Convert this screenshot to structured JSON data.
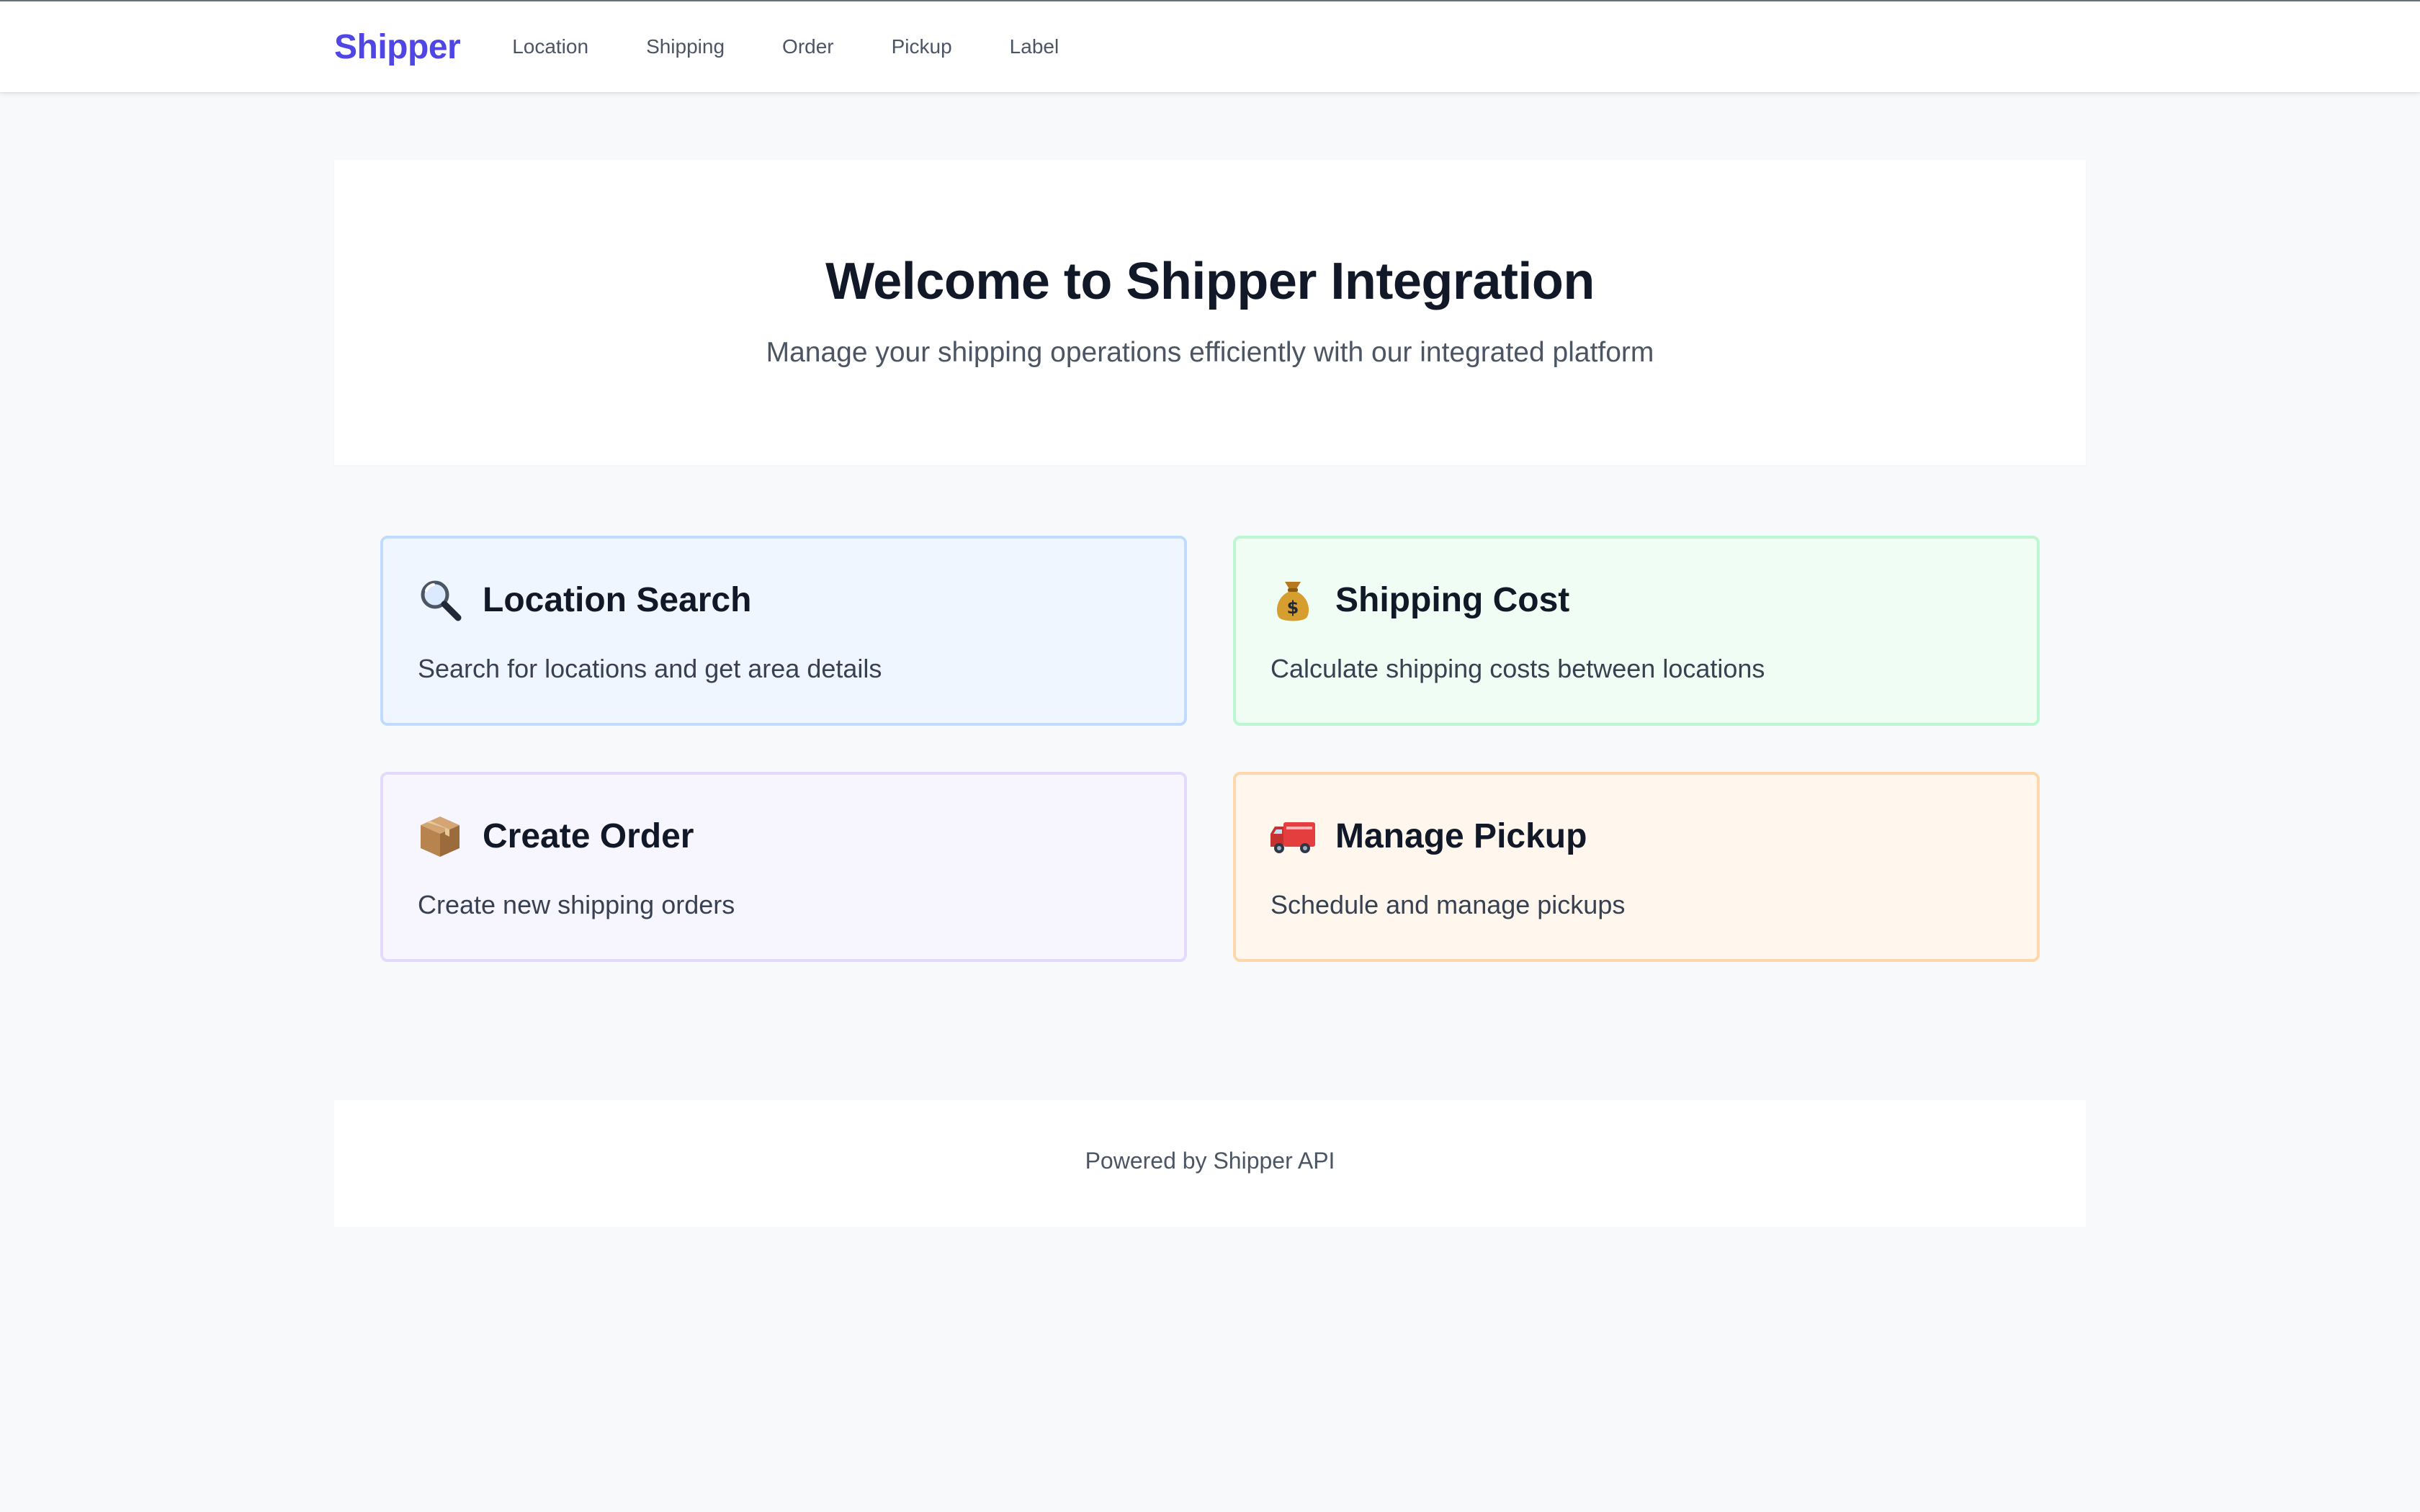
{
  "navbar": {
    "brand": "Shipper",
    "links": [
      "Location",
      "Shipping",
      "Order",
      "Pickup",
      "Label"
    ]
  },
  "hero": {
    "title": "Welcome to Shipper Integration",
    "subtitle": "Manage your shipping operations efficiently with our integrated platform"
  },
  "cards": [
    {
      "icon": "magnifying-glass-icon",
      "title": "Location Search",
      "description": "Search for locations and get area details",
      "color": "#eff6ff"
    },
    {
      "icon": "money-bag-icon",
      "title": "Shipping Cost",
      "description": "Calculate shipping costs between locations",
      "color": "#f0fdf4"
    },
    {
      "icon": "package-icon",
      "title": "Create Order",
      "description": "Create new shipping orders",
      "color": "#f7f5fe"
    },
    {
      "icon": "delivery-truck-icon",
      "title": "Manage Pickup",
      "description": "Schedule and manage pickups",
      "color": "#fff7ed"
    }
  ],
  "footer": {
    "text": "Powered by Shipper API"
  },
  "colors": {
    "brand": "#4f46e5",
    "page_background": "#f8f9fb"
  }
}
